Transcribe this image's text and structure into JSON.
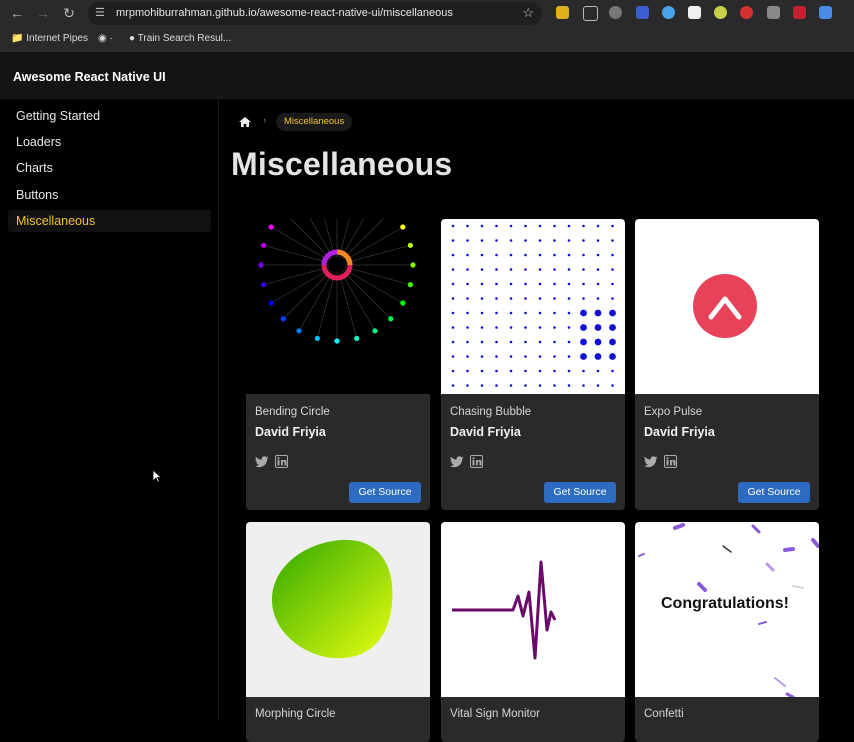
{
  "browser": {
    "url": "mrpmohiburrahman.github.io/awesome-react-native-ui/miscellaneous",
    "bookmarks": [
      "Internet Pipes",
      "Train Search Resul..."
    ]
  },
  "app": {
    "title": "Awesome React Native UI"
  },
  "sidebar": {
    "items": [
      {
        "label": "Getting Started"
      },
      {
        "label": "Loaders"
      },
      {
        "label": "Charts"
      },
      {
        "label": "Buttons"
      },
      {
        "label": "Miscellaneous"
      }
    ],
    "active": "Miscellaneous"
  },
  "breadcrumb": {
    "current": "Miscellaneous"
  },
  "page": {
    "title": "Miscellaneous"
  },
  "cards": [
    {
      "name": "Bending Circle",
      "author": "David Friyia",
      "button": "Get Source"
    },
    {
      "name": "Chasing Bubble",
      "author": "David Friyia",
      "button": "Get Source"
    },
    {
      "name": "Expo Pulse",
      "author": "David Friyia",
      "button": "Get Source"
    },
    {
      "name": "Morphing Circle"
    },
    {
      "name": "Vital Sign Monitor"
    },
    {
      "name": "Confetti",
      "preview_text": "Congratulations!"
    }
  ],
  "colors": {
    "accent": "#f2c230",
    "button": "#2d6bc0",
    "pulse": "#e8415a",
    "ecg": "#6a0a6a"
  }
}
